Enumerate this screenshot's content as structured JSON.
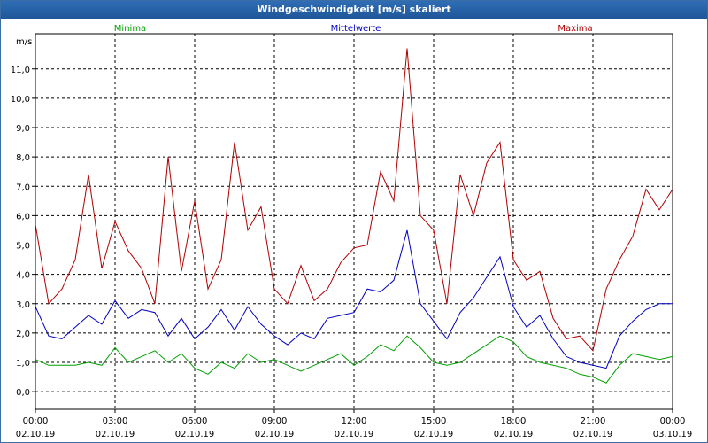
{
  "window": {
    "title": "Windgeschwindigkeit [m/s] skaliert"
  },
  "colors": {
    "minima": "#00a000",
    "mittel": "#0000c0",
    "maxima": "#b00000",
    "grid": "#000000",
    "title_bg": "#1f5799"
  },
  "chart_data": {
    "type": "line",
    "title": "Windgeschwindigkeit [m/s] skaliert",
    "ylabel": "m/s",
    "xlabel": "",
    "ylim": [
      -0.6,
      12.2
    ],
    "grid": true,
    "legend_position": "top",
    "y_ticks": [
      "0,0",
      "1,0",
      "2,0",
      "3,0",
      "4,0",
      "5,0",
      "6,0",
      "7,0",
      "8,0",
      "9,0",
      "10,0",
      "11,0"
    ],
    "x_ticks": [
      {
        "time": "00:00",
        "date": "02.10.19"
      },
      {
        "time": "03:00",
        "date": "02.10.19"
      },
      {
        "time": "06:00",
        "date": "02.10.19"
      },
      {
        "time": "09:00",
        "date": "02.10.19"
      },
      {
        "time": "12:00",
        "date": "02.10.19"
      },
      {
        "time": "15:00",
        "date": "02.10.19"
      },
      {
        "time": "18:00",
        "date": "02.10.19"
      },
      {
        "time": "21:00",
        "date": "02.10.19"
      },
      {
        "time": "00:00",
        "date": "03.10.19"
      }
    ],
    "x_hours": [
      0,
      0.5,
      1,
      1.5,
      2,
      2.5,
      3,
      3.5,
      4,
      4.5,
      5,
      5.5,
      6,
      6.5,
      7,
      7.5,
      8,
      8.5,
      9,
      9.5,
      10,
      10.5,
      11,
      11.5,
      12,
      12.5,
      13,
      13.5,
      14,
      14.5,
      15,
      15.5,
      16,
      16.5,
      17,
      17.5,
      18,
      18.5,
      19,
      19.5,
      20,
      20.5,
      21,
      21.5,
      22,
      22.5,
      23,
      23.5,
      24
    ],
    "series": [
      {
        "name": "Minima",
        "color": "#00a000",
        "values": [
          1.1,
          0.9,
          0.9,
          0.9,
          1.0,
          0.9,
          1.5,
          1.0,
          1.2,
          1.4,
          1.0,
          1.3,
          0.8,
          0.6,
          1.0,
          0.8,
          1.3,
          1.0,
          1.1,
          0.9,
          0.7,
          0.9,
          1.1,
          1.3,
          0.9,
          1.2,
          1.6,
          1.4,
          1.9,
          1.5,
          1.0,
          0.9,
          1.0,
          1.3,
          1.6,
          1.9,
          1.7,
          1.2,
          1.0,
          0.9,
          0.8,
          0.6,
          0.5,
          0.3,
          0.9,
          1.3,
          1.2,
          1.1,
          1.2
        ]
      },
      {
        "name": "Mittelwerte",
        "color": "#0000c0",
        "values": [
          2.9,
          1.9,
          1.8,
          2.2,
          2.6,
          2.3,
          3.1,
          2.5,
          2.8,
          2.7,
          1.9,
          2.5,
          1.8,
          2.2,
          2.8,
          2.1,
          2.9,
          2.3,
          1.9,
          1.6,
          2.0,
          1.8,
          2.5,
          2.6,
          2.7,
          3.5,
          3.4,
          3.8,
          5.5,
          3.0,
          2.4,
          1.8,
          2.7,
          3.2,
          3.9,
          4.6,
          2.9,
          2.2,
          2.6,
          1.8,
          1.2,
          1.0,
          0.9,
          0.8,
          1.9,
          2.4,
          2.8,
          3.0,
          3.0
        ]
      },
      {
        "name": "Maxima",
        "color": "#b00000",
        "values": [
          5.7,
          3.0,
          3.5,
          4.5,
          7.4,
          4.2,
          5.8,
          4.8,
          4.2,
          3.0,
          8.0,
          4.1,
          6.5,
          3.5,
          4.5,
          8.5,
          5.5,
          6.3,
          3.5,
          3.0,
          4.3,
          3.1,
          3.5,
          4.4,
          4.9,
          5.0,
          7.5,
          6.5,
          11.7,
          6.0,
          5.5,
          3.0,
          7.4,
          6.0,
          7.8,
          8.5,
          4.5,
          3.8,
          4.1,
          2.5,
          1.8,
          1.9,
          1.4,
          3.5,
          4.5,
          5.3,
          6.9,
          6.2,
          6.9
        ]
      }
    ]
  }
}
